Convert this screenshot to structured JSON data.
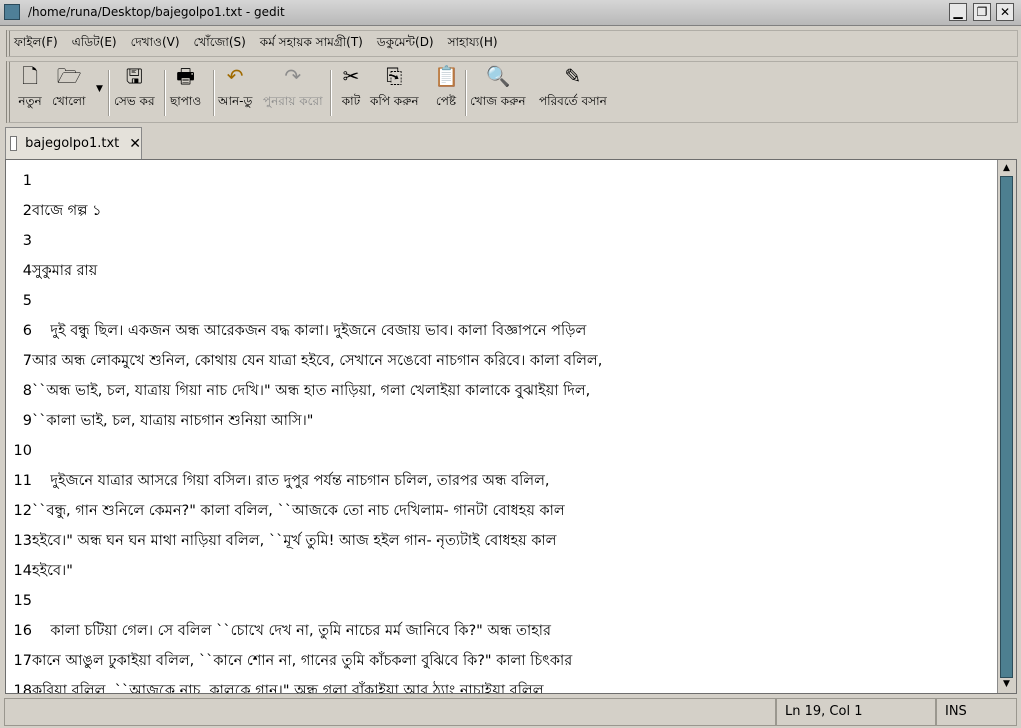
{
  "window": {
    "title": "/home/runa/Desktop/bajegolpo1.txt - gedit",
    "minimize": "▁",
    "maximize": "❐",
    "close": "✕"
  },
  "menu": [
    "ফাইল(F)",
    "এডিট(E)",
    "দেখাও(V)",
    "খোঁজো(S)",
    "কর্ম সহায়ক সামগ্রী(T)",
    "ডকুমেন্ট(D)",
    "সাহায্য(H)"
  ],
  "toolbar": {
    "new": "নতুন",
    "open": "খোলো",
    "save": "সেভ কর",
    "print": "ছাপাও",
    "undo": "আন-ডু",
    "redo": "পুনরায় করো",
    "cut": "কাট",
    "copy": "কপি করুন",
    "paste": "পেষ্ট",
    "find": "খোজ করুন",
    "replace": "পরিবর্তে বসান"
  },
  "tab": {
    "filename": "bajegolpo1.txt",
    "close": "✕"
  },
  "editor": {
    "lines": [
      {
        "n": "1",
        "text": ""
      },
      {
        "n": "2",
        "text": "বাজে গল্প ১"
      },
      {
        "n": "3",
        "text": ""
      },
      {
        "n": "4",
        "text": "সুকুমার রায়"
      },
      {
        "n": "5",
        "text": ""
      },
      {
        "n": "6",
        "text": "    দুই বন্ধু ছিল। একজন অন্ধ আরেকজন বদ্ধ কালা। দুইজনে বেজায় ভাব। কালা বিজ্ঞাপনে পড়িল"
      },
      {
        "n": "7",
        "text": "আর অন্ধ লোকমুখে শুনিল, কোথায় যেন যাত্রা হইবে, সেখানে সঙেবো নাচগান করিবে। কালা বলিল,"
      },
      {
        "n": "8",
        "text": "``অন্ধ ভাই, চল, যাত্রায় গিয়া নাচ দেখি।\" অন্ধ হাত নাড়িয়া, গলা খেলাইয়া কালাকে বুঝাইয়া দিল,"
      },
      {
        "n": "9",
        "text": "``কালা ভাই, চল, যাত্রায় নাচগান শুনিয়া আসি।\""
      },
      {
        "n": "10",
        "text": ""
      },
      {
        "n": "11",
        "text": "    দুইজনে যাত্রার আসরে গিয়া বসিল। রাত দুপুর পর্যন্ত নাচগান চলিল, তারপর অন্ধ বলিল,"
      },
      {
        "n": "12",
        "text": "``বন্ধু, গান শুনিলে কেমন?\" কালা বলিল, ``আজকে তো নাচ দেখিলাম- গানটা বোধহয় কাল"
      },
      {
        "n": "13",
        "text": "হইবে।\" অন্ধ ঘন ঘন মাথা নাড়িয়া বলিল, ``মূর্খ তুমি! আজ হইল গান- নৃত্যটাই বোধহয় কাল"
      },
      {
        "n": "14",
        "text": "হইবে।\""
      },
      {
        "n": "15",
        "text": ""
      },
      {
        "n": "16",
        "text": "    কালা চটিয়া গেল। সে বলিল ``চোখে দেখ না, তুমি নাচের মর্ম জানিবে কি?\" অন্ধ তাহার"
      },
      {
        "n": "17",
        "text": "কানে আঙুল ঢুকাইয়া বলিল, ``কানে শোন না, গানের তুমি কাঁচকলা বুঝিবে কি?\" কালা চিৎকার"
      },
      {
        "n": "18",
        "text": "করিয়া বলিল, ``আজকে নাচ, কালকে গান।\" অন্ধ গলা বাঁকাইয়া আর ঠ্যাং নাচাইয়া বলিল"
      }
    ]
  },
  "status": {
    "position": "Ln 19, Col 1",
    "mode": "INS"
  }
}
